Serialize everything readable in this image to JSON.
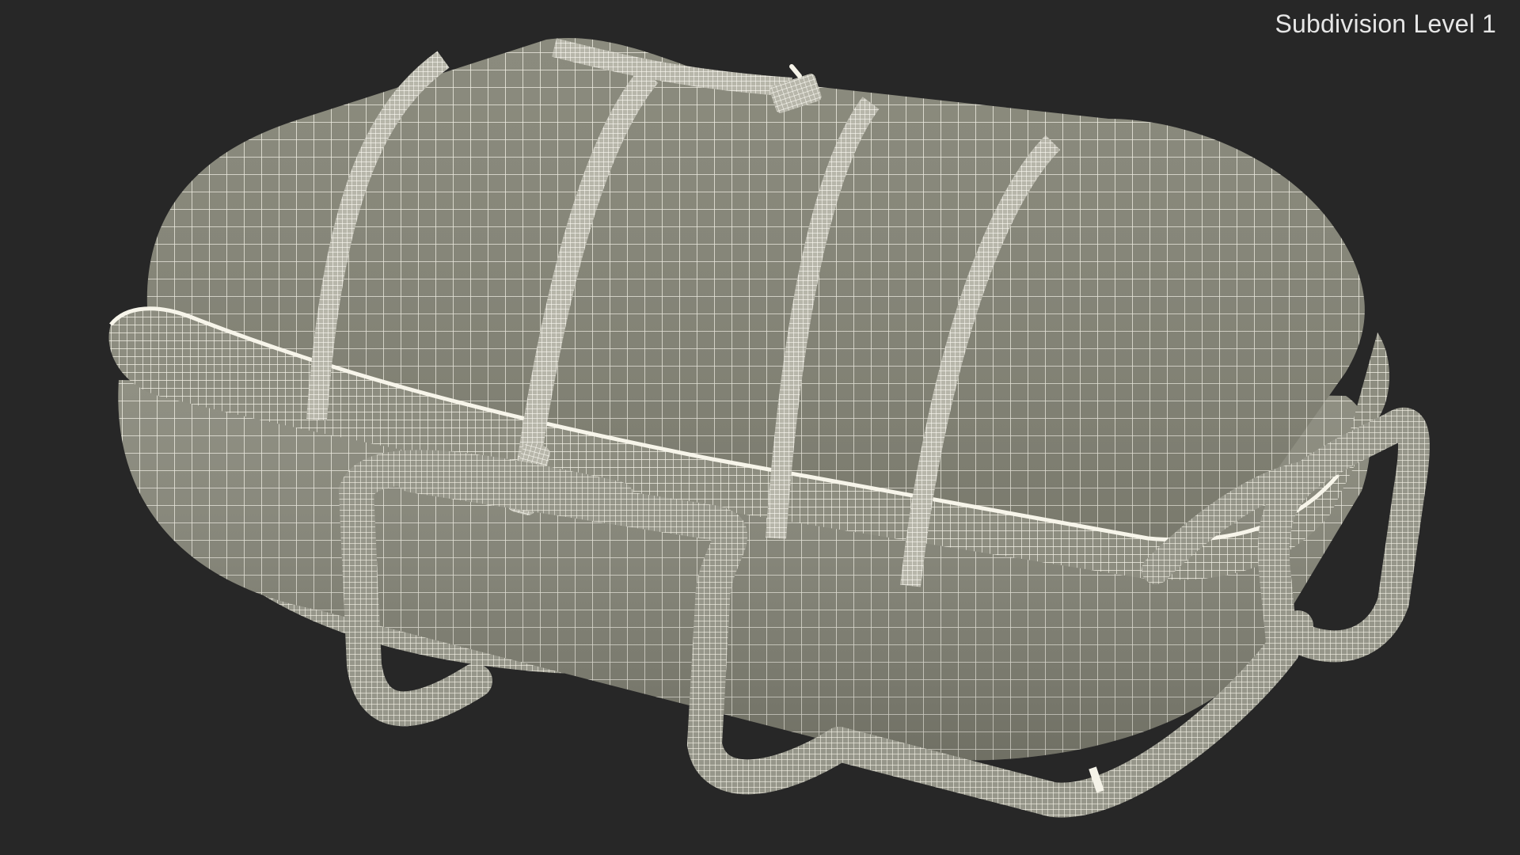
{
  "viewport": {
    "label": "Subdivision Level 1",
    "background_color": "#272727",
    "label_color": "#e6e6e6"
  },
  "model": {
    "render_mode": "wireframe-on-shaded",
    "surface_color": "#8a8a7c",
    "wire_color": "#f2f0e4"
  }
}
